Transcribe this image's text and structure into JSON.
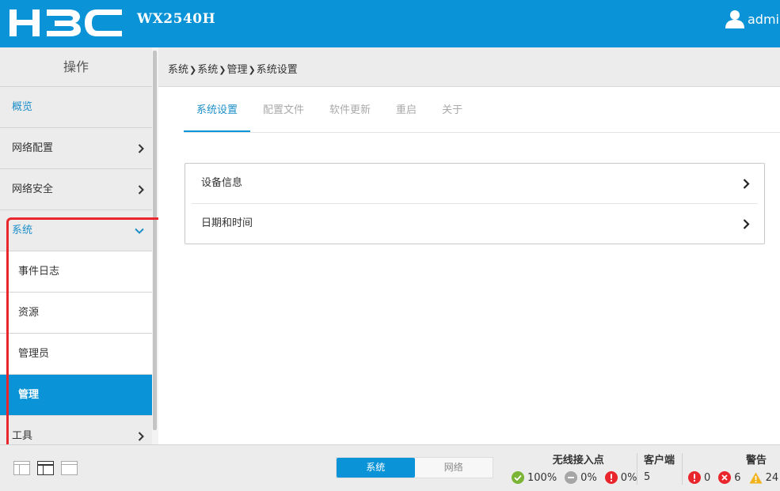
{
  "header": {
    "model": "WX2540H",
    "user": "admin"
  },
  "sidebar": {
    "title": "操作",
    "items": [
      {
        "label": "概览"
      },
      {
        "label": "网络配置"
      },
      {
        "label": "网络安全"
      },
      {
        "label": "系统"
      },
      {
        "label": "工具"
      }
    ],
    "system_children": [
      {
        "label": "事件日志"
      },
      {
        "label": "资源"
      },
      {
        "label": "管理员"
      },
      {
        "label": "管理"
      }
    ],
    "active_child": "管理"
  },
  "breadcrumb": [
    "系统",
    "系统",
    "管理",
    "系统设置"
  ],
  "tabs": [
    {
      "label": "系统设置",
      "active": true
    },
    {
      "label": "配置文件"
    },
    {
      "label": "软件更新"
    },
    {
      "label": "重启"
    },
    {
      "label": "关于"
    }
  ],
  "panel": {
    "rows": [
      {
        "label": "设备信息"
      },
      {
        "label": "日期和时间"
      }
    ]
  },
  "footer": {
    "toggle": {
      "system": "系统",
      "network": "网络"
    },
    "wireless_ap": {
      "title": "无线接入点",
      "online": "100%",
      "offline": "0%",
      "fault": "0%"
    },
    "clients": {
      "title": "客户端",
      "count": "5"
    },
    "alarms": {
      "title": "警告",
      "critical": "0",
      "major": "6",
      "warning": "24"
    }
  },
  "colors": {
    "brand": "#0a93d6",
    "highlight": "#e8262b",
    "ok": "#7bb536",
    "error": "#e8262b",
    "warn": "#f2b21c"
  }
}
